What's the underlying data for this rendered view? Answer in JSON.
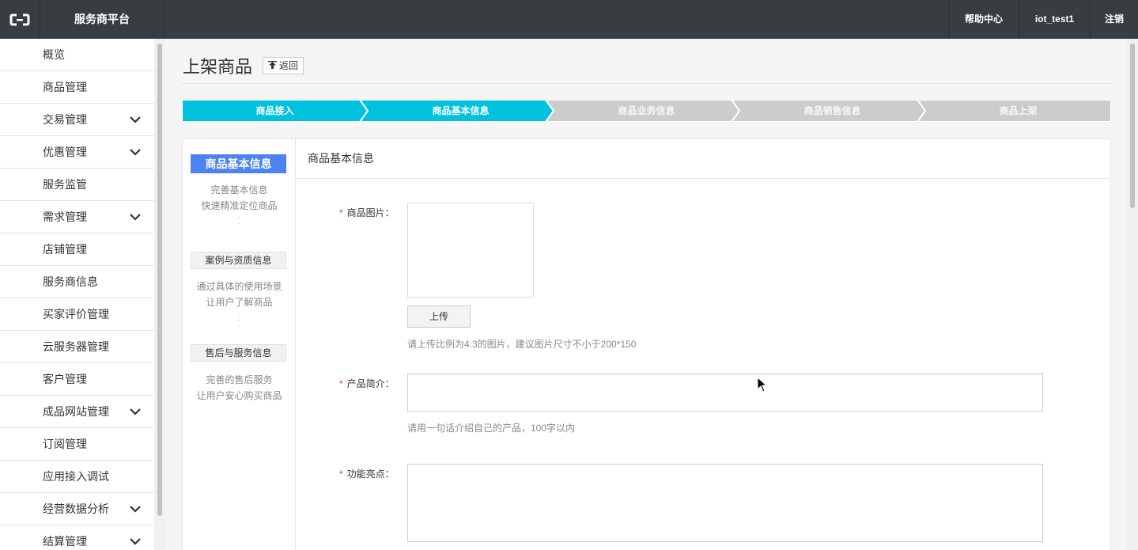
{
  "header": {
    "app_title": "服务商平台",
    "logo_icon": "aliyun-logo-icon",
    "help_label": "帮助中心",
    "user_label": "iot_test1",
    "logout_label": "注销"
  },
  "sidebar": {
    "items": [
      {
        "label": "概览",
        "expandable": false
      },
      {
        "label": "商品管理",
        "expandable": false
      },
      {
        "label": "交易管理",
        "expandable": true
      },
      {
        "label": "优惠管理",
        "expandable": true
      },
      {
        "label": "服务监管",
        "expandable": false
      },
      {
        "label": "需求管理",
        "expandable": true
      },
      {
        "label": "店铺管理",
        "expandable": false
      },
      {
        "label": "服务商信息",
        "expandable": false
      },
      {
        "label": "买家评价管理",
        "expandable": false
      },
      {
        "label": "云服务器管理",
        "expandable": false
      },
      {
        "label": "客户管理",
        "expandable": false
      },
      {
        "label": "成品网站管理",
        "expandable": true
      },
      {
        "label": "订阅管理",
        "expandable": false
      },
      {
        "label": "应用接入调试",
        "expandable": false
      },
      {
        "label": "经营数据分析",
        "expandable": true
      },
      {
        "label": "结算管理",
        "expandable": true
      }
    ]
  },
  "page": {
    "title": "上架商品",
    "back_label": "返回"
  },
  "steps": {
    "active_color": "#00c1de",
    "inactive_color": "#cccccc",
    "items": [
      {
        "label": "商品接入",
        "active": true
      },
      {
        "label": "商品基本信息",
        "active": true
      },
      {
        "label": "商品业务信息",
        "active": false
      },
      {
        "label": "商品销售信息",
        "active": false
      },
      {
        "label": "商品上架",
        "active": false
      }
    ]
  },
  "guide": {
    "active_tab": "商品基本信息",
    "active_desc_1": "完善基本信息",
    "active_desc_2": "快速精准定位商品",
    "tab2": "案例与资质信息",
    "tab2_desc_1": "通过具体的使用场景",
    "tab2_desc_2": "让用户了解商品",
    "tab3": "售后与服务信息",
    "tab3_desc_1": "完善的售后服务",
    "tab3_desc_2": "让用户安心购买商品",
    "accent_color": "#4d83f0"
  },
  "form": {
    "section_title": "商品基本信息",
    "required_mark": "*",
    "image_label": "商品图片：",
    "upload_label": "上传",
    "image_hint": "请上传比例为4:3的图片，建议图片尺寸不小于200*150",
    "intro_label": "产品简介：",
    "intro_value": "",
    "intro_hint": "请用一句话介绍自己的产品，100字以内",
    "feature_label": "功能亮点：",
    "feature_value": ""
  }
}
